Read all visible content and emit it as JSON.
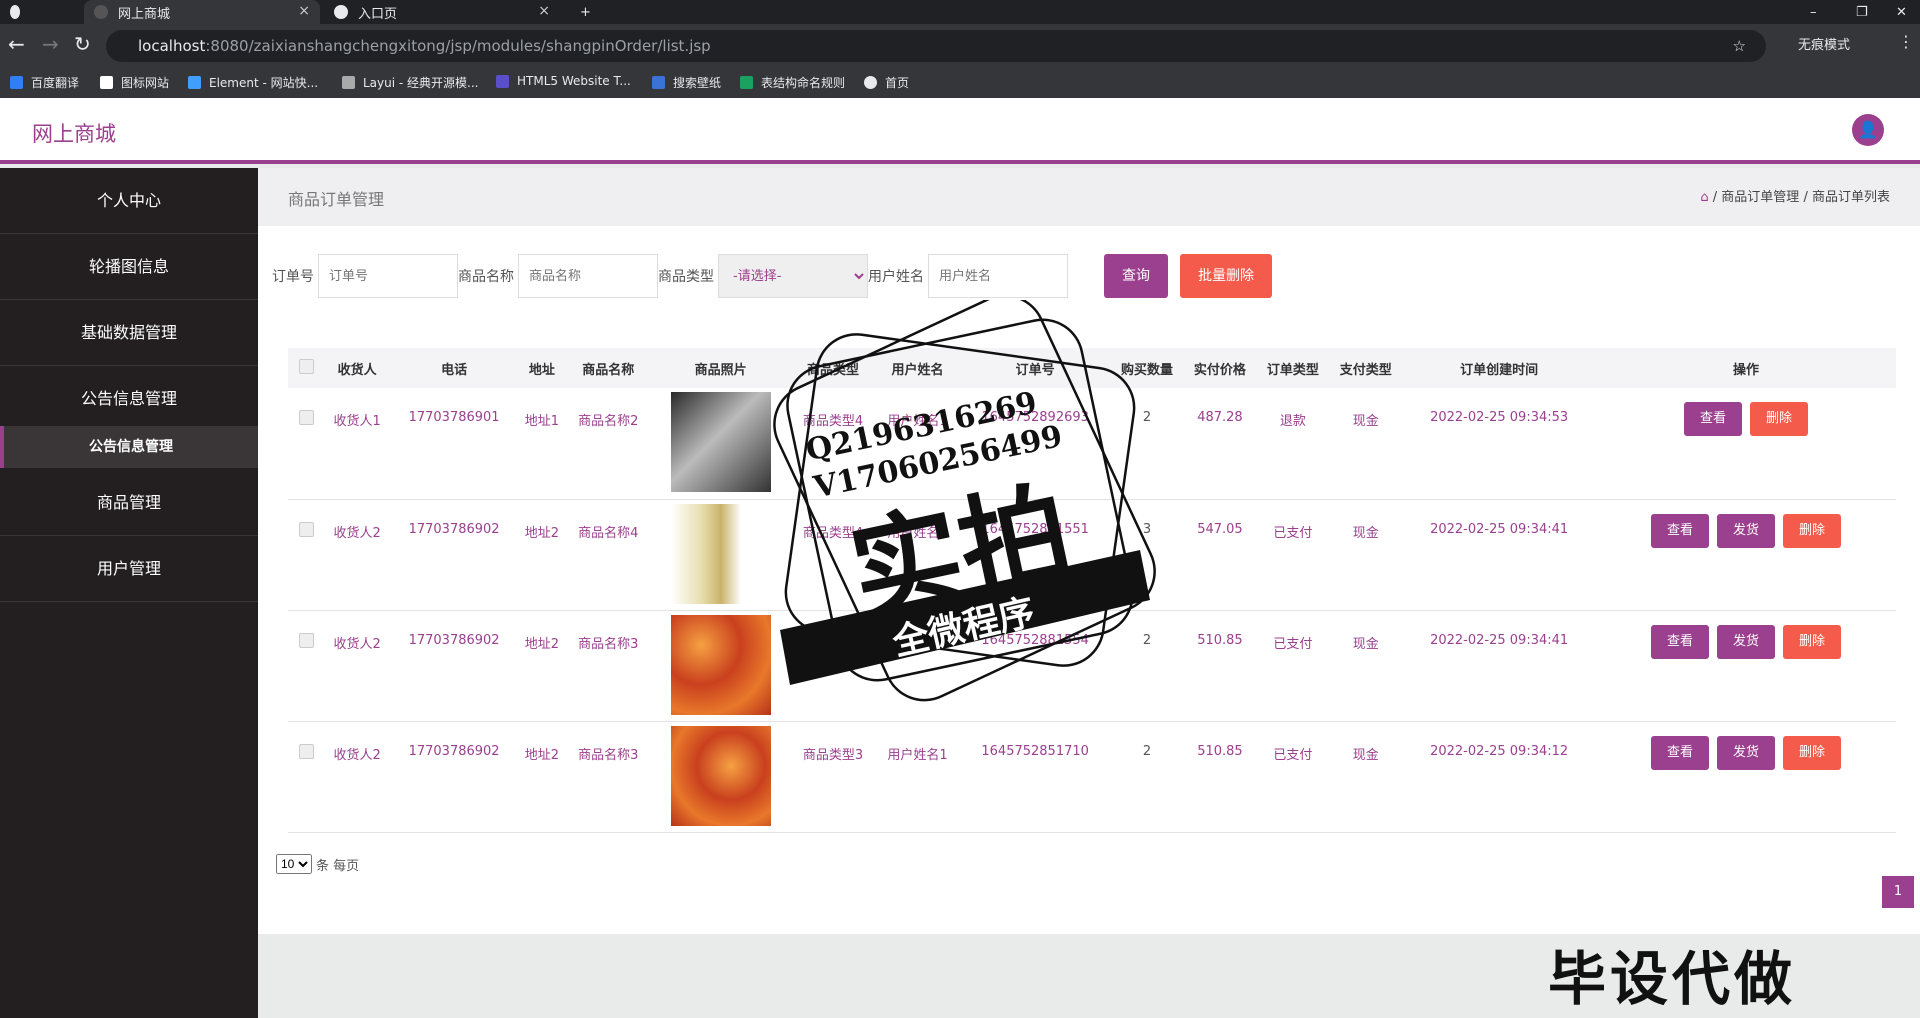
{
  "browser": {
    "tabs": [
      {
        "label": "网上商城"
      },
      {
        "label": "入口页"
      }
    ],
    "url_host": "localhost",
    "url_path": ":8080/zaixianshangchengxitong/jsp/modules/shangpinOrder/list.jsp",
    "incognito_label": "无痕模式",
    "bookmarks": [
      "百度翻译",
      "图标网站",
      "Element - 网站快...",
      "Layui - 经典开源模...",
      "HTML5 Website T...",
      "搜索壁纸",
      "表结构命名规则",
      "首页"
    ]
  },
  "header": {
    "brand": "网上商城"
  },
  "sidebar": {
    "items": [
      {
        "label": "个人中心"
      },
      {
        "label": "轮播图信息"
      },
      {
        "label": "基础数据管理"
      },
      {
        "label": "公告信息管理"
      },
      {
        "label": "公告信息管理"
      },
      {
        "label": "商品管理"
      },
      {
        "label": "用户管理"
      }
    ]
  },
  "page": {
    "title": "商品订单管理",
    "breadcrumb": [
      "商品订单管理",
      "商品订单列表"
    ],
    "breadcrumb_sep": "/"
  },
  "search": {
    "order_label": "订单号",
    "order_placeholder": "订单号",
    "name_label": "商品名称",
    "name_placeholder": "商品名称",
    "type_label": "商品类型",
    "type_selected": "-请选择-",
    "user_label": "用户姓名",
    "user_placeholder": "用户姓名",
    "query_btn": "查询",
    "batch_delete_btn": "批量删除"
  },
  "table": {
    "columns": [
      "收货人",
      "电话",
      "地址",
      "商品名称",
      "商品照片",
      "商品类型",
      "用户姓名",
      "订单号",
      "购买数量",
      "实付价格",
      "订单类型",
      "支付类型",
      "订单创建时间",
      "操作"
    ],
    "rows": [
      {
        "receiver": "收货人1",
        "phone": "17703786901",
        "address": "地址1",
        "product": "商品名称2",
        "type": "商品类型4",
        "user": "用户姓名1",
        "order_no": "1645752892693",
        "qty": "2",
        "price": "487.28",
        "order_type": "退款",
        "pay_type": "现金",
        "created": "2022-02-25 09:34:53",
        "actions": [
          "查看",
          "删除"
        ]
      },
      {
        "receiver": "收货人2",
        "phone": "17703786902",
        "address": "地址2",
        "product": "商品名称4",
        "type": "商品类型4",
        "user": "用户姓名2",
        "order_no": "1645752881551",
        "qty": "3",
        "price": "547.05",
        "order_type": "已支付",
        "pay_type": "现金",
        "created": "2022-02-25 09:34:41",
        "actions": [
          "查看",
          "发货",
          "删除"
        ]
      },
      {
        "receiver": "收货人2",
        "phone": "17703786902",
        "address": "地址2",
        "product": "商品名称3",
        "type": "商品类型3",
        "user": "用户姓名2",
        "order_no": "1645752881554",
        "qty": "2",
        "price": "510.85",
        "order_type": "已支付",
        "pay_type": "现金",
        "created": "2022-02-25 09:34:41",
        "actions": [
          "查看",
          "发货",
          "删除"
        ]
      },
      {
        "receiver": "收货人2",
        "phone": "17703786902",
        "address": "地址2",
        "product": "商品名称3",
        "type": "商品类型3",
        "user": "用户姓名1",
        "order_no": "1645752851710",
        "qty": "2",
        "price": "510.85",
        "order_type": "已支付",
        "pay_type": "现金",
        "created": "2022-02-25 09:34:12",
        "actions": [
          "查看",
          "发货",
          "删除"
        ]
      }
    ]
  },
  "pager": {
    "size": "10",
    "unit": "条 每页",
    "current": "1"
  },
  "watermark": {
    "q": "Q2196316269",
    "v": "V17060256499",
    "main": "实拍",
    "sub": "全微程序",
    "corner": "毕设代做"
  },
  "colors": {
    "primary": "#9b3f8f",
    "danger": "#f45b4b",
    "sidebar": "#231f20"
  }
}
